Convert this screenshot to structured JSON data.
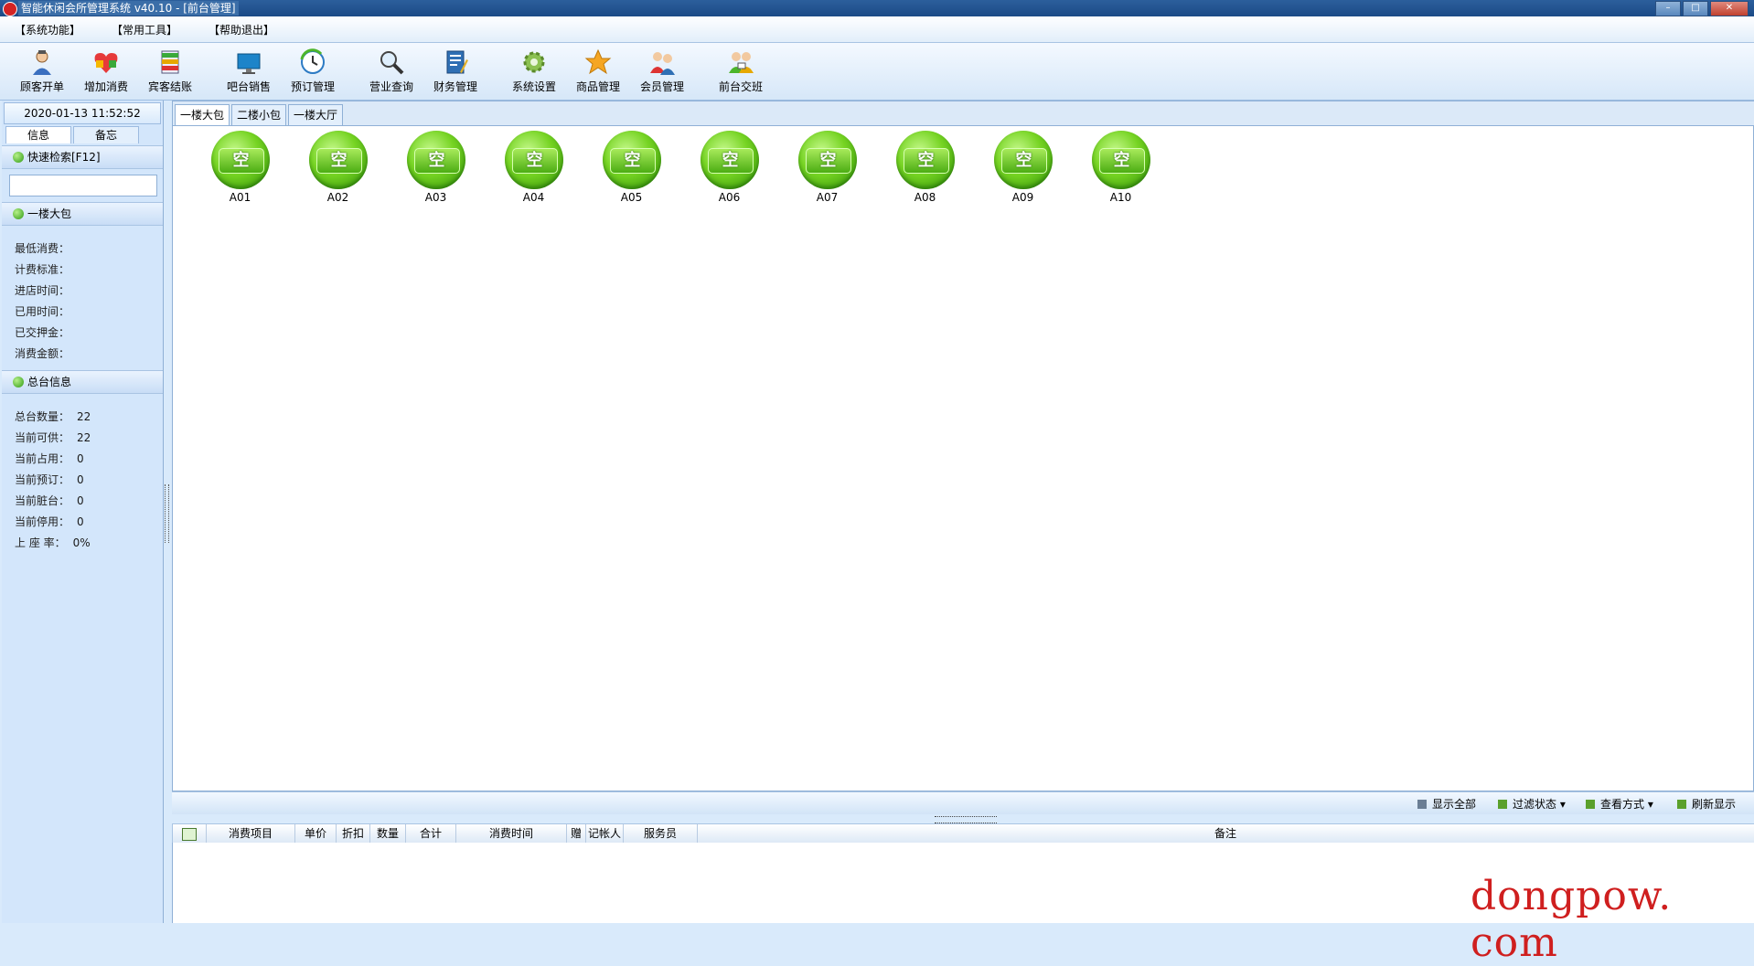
{
  "window": {
    "title": "智能休闲会所管理系统 v40.10 - [前台管理]",
    "controls": {
      "minimize": "–",
      "maximize": "□",
      "close": "✕"
    }
  },
  "menu": [
    "【系统功能】",
    "【常用工具】",
    "【帮助退出】"
  ],
  "toolbar": [
    {
      "label": "顾客开单",
      "icon": "customer-icon"
    },
    {
      "label": "增加消费",
      "icon": "add-consumption-icon"
    },
    {
      "label": "宾客结账",
      "icon": "checkout-icon"
    },
    {
      "label": "吧台销售",
      "icon": "bar-sales-icon"
    },
    {
      "label": "预订管理",
      "icon": "reservation-icon"
    },
    {
      "label": "营业查询",
      "icon": "search-icon"
    },
    {
      "label": "财务管理",
      "icon": "finance-icon"
    },
    {
      "label": "系统设置",
      "icon": "gear-icon"
    },
    {
      "label": "商品管理",
      "icon": "star-icon"
    },
    {
      "label": "会员管理",
      "icon": "members-icon"
    },
    {
      "label": "前台交班",
      "icon": "handover-icon"
    }
  ],
  "sidebar": {
    "datetime": "2020-01-13 11:52:52",
    "tabs": [
      "信息",
      "备忘"
    ],
    "quick_search": "快速检索[F12]",
    "search_value": "",
    "area_title": "一楼大包",
    "info_labels": [
      "最低消费：",
      "计费标准：",
      "进店时间：",
      "已用时间：",
      "已交押金：",
      "消费金额："
    ],
    "summary_title": "总台信息",
    "stats": [
      {
        "label": "总台数量：",
        "value": "22"
      },
      {
        "label": "当前可供：",
        "value": "22"
      },
      {
        "label": "当前占用：",
        "value": "0"
      },
      {
        "label": "当前预订：",
        "value": "0"
      },
      {
        "label": "当前脏台：",
        "value": "0"
      },
      {
        "label": "当前停用：",
        "value": "0"
      },
      {
        "label": "上 座 率：",
        "value": "0%"
      }
    ]
  },
  "floor_tabs": [
    "一楼大包",
    "二楼小包",
    "一楼大厅"
  ],
  "rooms": [
    {
      "id": "A01",
      "status": "空"
    },
    {
      "id": "A02",
      "status": "空"
    },
    {
      "id": "A03",
      "status": "空"
    },
    {
      "id": "A04",
      "status": "空"
    },
    {
      "id": "A05",
      "status": "空"
    },
    {
      "id": "A06",
      "status": "空"
    },
    {
      "id": "A07",
      "status": "空"
    },
    {
      "id": "A08",
      "status": "空"
    },
    {
      "id": "A09",
      "status": "空"
    },
    {
      "id": "A10",
      "status": "空"
    }
  ],
  "bottom_actions": [
    "显示全部",
    "过滤状态 ▾",
    "查看方式 ▾",
    "刷新显示"
  ],
  "grid_columns": [
    "消费项目",
    "单价",
    "折扣",
    "数量",
    "合计",
    "消费时间",
    "赠",
    "记帐人",
    "服务员",
    "备注"
  ],
  "watermark": "dongpow. com",
  "colors": {
    "room_green": "#5cc118",
    "panel_blue": "#d3e6fb",
    "title_blue": "#1b4a86",
    "watermark_red": "#cf1f1f"
  }
}
